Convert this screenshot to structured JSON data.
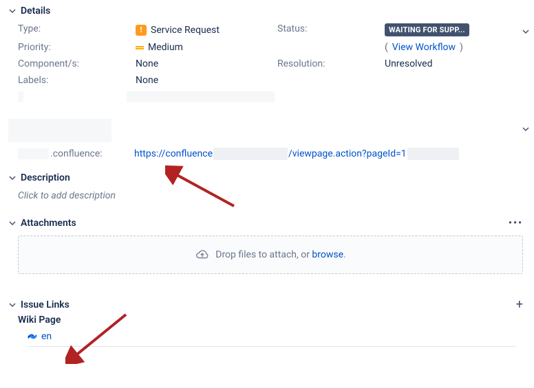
{
  "sections": {
    "details": "Details",
    "description": "Description",
    "attachments": "Attachments",
    "issueLinks": "Issue Links",
    "wikiPage": "Wiki Page"
  },
  "details": {
    "typeLabel": "Type:",
    "typeValue": "Service Request",
    "statusLabel": "Status:",
    "statusValue": "WAITING FOR SUPP...",
    "priorityLabel": "Priority:",
    "priorityValue": "Medium",
    "viewWorkflow": "View Workflow",
    "componentsLabel": "Component/s:",
    "componentsValue": "None",
    "resolutionLabel": "Resolution:",
    "resolutionValue": "Unresolved",
    "labelsLabel": "Labels:",
    "labelsValue": "None",
    "confluenceFieldSuffix": ".confluence:",
    "confluenceUrlPart1": "https://confluence",
    "confluenceUrlPart2": "/viewpage.action?pageId=1"
  },
  "description": {
    "placeholder": "Click to add description"
  },
  "attachments": {
    "dropText": "Drop files to attach, or ",
    "browseText": "browse",
    "period": "."
  },
  "wikiLink": {
    "text": "en"
  }
}
